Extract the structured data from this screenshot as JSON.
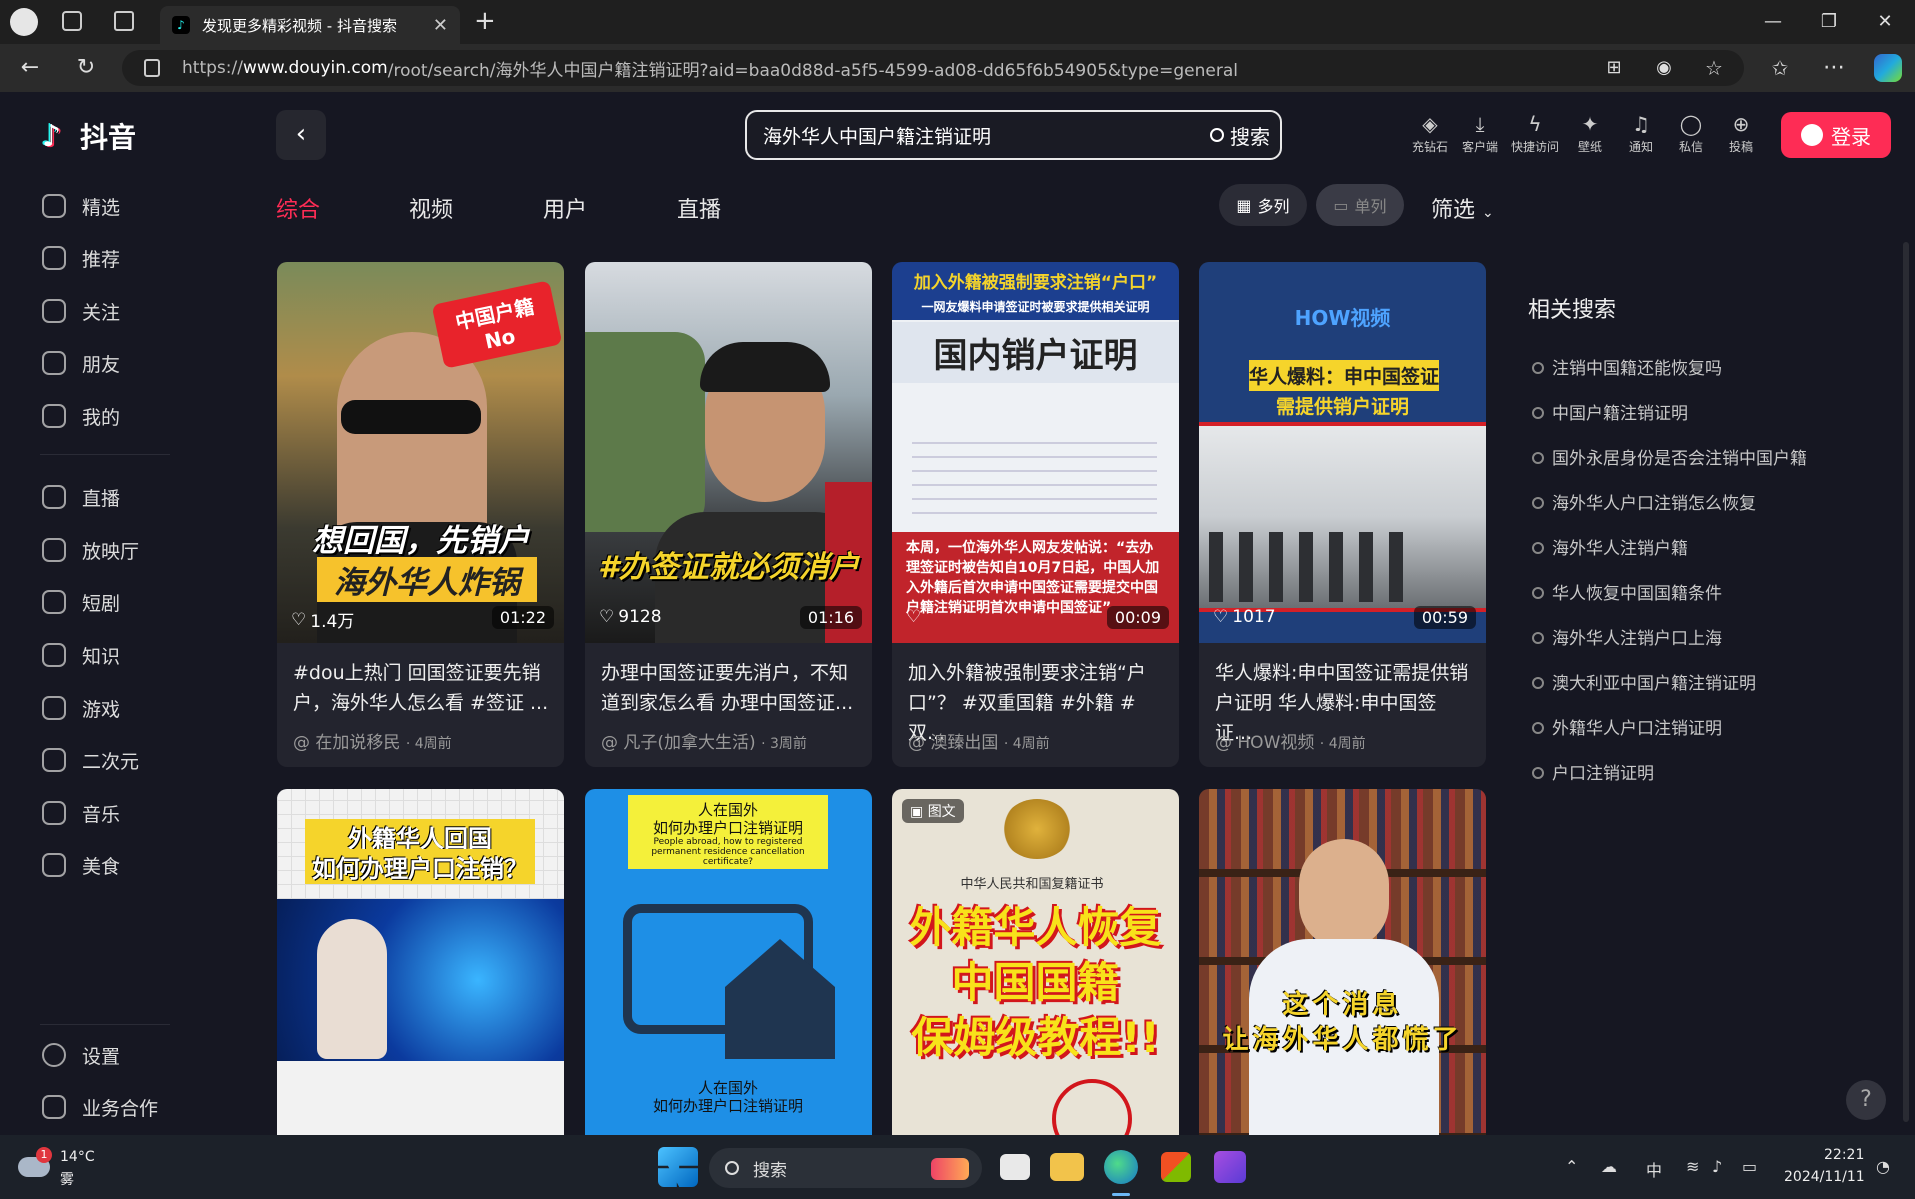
{
  "browser": {
    "tab_title": "发现更多精彩视频 - 抖音搜索",
    "url_prefix": "https://",
    "url_host": "www.douyin.com",
    "url_path": "/root/search/海外华人中国户籍注销证明?aid=baa0d88d-a5f5-4599-ad08-dd65f6b54905&type=general"
  },
  "app": {
    "logo_text": "抖音",
    "search_query": "海外华人中国户籍注销证明",
    "search_button": "搜索",
    "login_label": "登录"
  },
  "top_icons": [
    {
      "label": "充钻石",
      "icon": "diamond-icon"
    },
    {
      "label": "客户端",
      "icon": "download-icon"
    },
    {
      "label": "快捷访问",
      "icon": "lightning-icon"
    },
    {
      "label": "壁纸",
      "icon": "wallpaper-icon"
    },
    {
      "label": "通知",
      "icon": "bell-icon"
    },
    {
      "label": "私信",
      "icon": "message-icon"
    },
    {
      "label": "投稿",
      "icon": "upload-icon"
    }
  ],
  "sidebar": {
    "items": [
      {
        "label": "精选"
      },
      {
        "label": "推荐"
      },
      {
        "label": "关注"
      },
      {
        "label": "朋友"
      },
      {
        "label": "我的"
      },
      {
        "label": "直播"
      },
      {
        "label": "放映厅"
      },
      {
        "label": "短剧"
      },
      {
        "label": "知识"
      },
      {
        "label": "游戏"
      },
      {
        "label": "二次元"
      },
      {
        "label": "音乐"
      },
      {
        "label": "美食"
      }
    ],
    "bottom": [
      {
        "label": "设置"
      },
      {
        "label": "业务合作"
      }
    ]
  },
  "filter_tabs": [
    {
      "label": "综合",
      "active": true
    },
    {
      "label": "视频",
      "active": false
    },
    {
      "label": "用户",
      "active": false
    },
    {
      "label": "直播",
      "active": false
    }
  ],
  "view_multi": "多列",
  "view_single": "单列",
  "filter_label": "筛选",
  "videos": [
    {
      "likes": "1.4万",
      "duration": "01:22",
      "title": "#dou上热门 回国签证要先销户，海外华人怎么看 #签证 ...",
      "author": "@ 在加说移民",
      "age": "· 4周前",
      "overlay_top": "中国户籍 No",
      "overlay_line1": "想回国，先销户",
      "overlay_line2": "海外华人炸锅"
    },
    {
      "likes": "9128",
      "duration": "01:16",
      "title": "办理中国签证要先消户，不知道到家怎么看 办理中国签证...",
      "author": "@ 凡子(加拿大生活)",
      "age": "· 3周前",
      "overlay_line1": "#办签证就必须消户"
    },
    {
      "likes": "",
      "duration": "00:09",
      "title": "加入外籍被强制要求注销“户口”？ #双重国籍 #外籍 #双...",
      "author": "@ 澳臻出国",
      "age": "· 4周前",
      "overlay_top": "加入外籍被强制要求注销“户口”",
      "overlay_sub": "一网友爆料申请签证时被要求提供相关证明",
      "overlay_line1": "国内销户证明",
      "overlay_body": "本周，一位海外华人网友发帖说：“去办理签证时被告知自10月7日起，中国人加入外籍后首次申请中国签证需要提交中国户籍注销证明首次申请中国签证”"
    },
    {
      "likes": "1017",
      "duration": "00:59",
      "title": "华人爆料:申中国签证需提供销户证明 华人爆料:申中国签证...",
      "author": "@ HOW视频",
      "age": "· 4周前",
      "overlay_top": "HOW视频",
      "overlay_line1": "华人爆料：申中国签证",
      "overlay_line2": "需提供销户证明"
    }
  ],
  "videos_row2": [
    {
      "overlay_line1": "外籍华人回国",
      "overlay_line2": "如何办理户口注销？"
    },
    {
      "overlay_line1": "人在国外",
      "overlay_line2": "如何办理户口注销证明",
      "overlay_en": "People abroad, how to registered permanent residence cancellation certificate?"
    },
    {
      "badge": "图文",
      "overlay_line0": "中华人民共和国复籍证书",
      "overlay_line1": "外籍华人恢复",
      "overlay_line2": "中国国籍",
      "overlay_line3": "保姆级教程!!"
    },
    {
      "overlay_line1": "这个消息",
      "overlay_line2": "让海外华人都慌了"
    }
  ],
  "related": {
    "title": "相关搜索",
    "items": [
      "注销中国籍还能恢复吗",
      "中国户籍注销证明",
      "国外永居身份是否会注销中国户籍",
      "海外华人户口注销怎么恢复",
      "海外华人注销户籍",
      "华人恢复中国国籍条件",
      "海外华人注销户口上海",
      "澳大利亚中国户籍注销证明",
      "外籍华人户口注销证明",
      "户口注销证明"
    ]
  },
  "taskbar": {
    "weather_temp": "14°C",
    "weather_desc": "雾",
    "weather_badge": "1",
    "search_label": "搜索",
    "ime": "中",
    "time": "22:21",
    "date": "2024/11/11"
  }
}
